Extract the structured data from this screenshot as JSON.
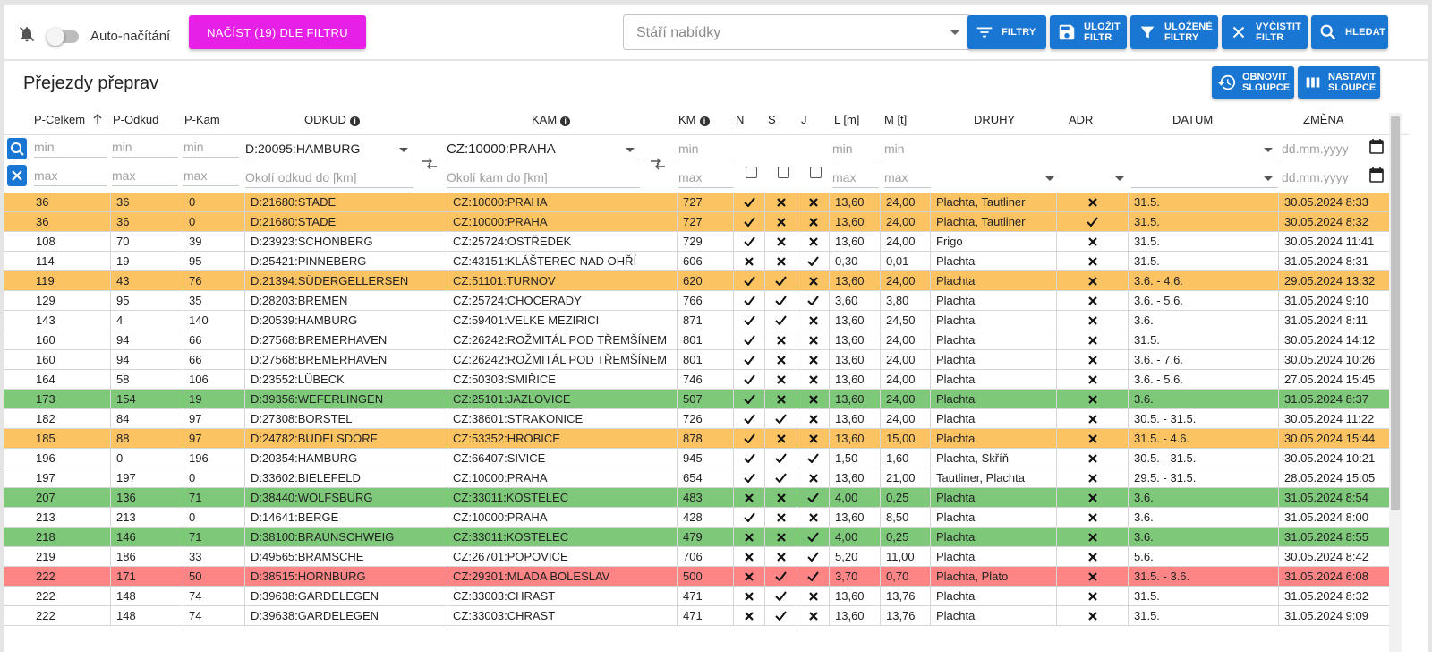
{
  "toolbar": {
    "auto_label": "Auto-načítání",
    "load_button": "NAČÍST (19) DLE FILTRU",
    "age_placeholder": "Stáří nabídky",
    "buttons": {
      "filters": "FILTRY",
      "save_filter_1": "ULOŽIT",
      "save_filter_2": "FILTR",
      "saved_filters_1": "ULOŽENÉ",
      "saved_filters_2": "FILTRY",
      "clear_filter_1": "VYČISTIT",
      "clear_filter_2": "FILTR",
      "search": "HLEDAT"
    },
    "colors": {
      "magenta": "#e620e6",
      "primary": "#1976d2",
      "indicator": "#f01e1e"
    }
  },
  "card": {
    "title": "Přejezdy přeprav",
    "refresh_1": "OBNOVIT",
    "refresh_2": "SLOUPCE",
    "setup_1": "NASTAVIT",
    "setup_2": "SLOUPCE"
  },
  "columns": {
    "p_celkem": "P-Celkem",
    "p_odkud": "P-Odkud",
    "p_kam": "P-Kam",
    "odkud": "ODKUD",
    "kam": "KAM",
    "km": "KM",
    "n": "N",
    "s": "S",
    "j": "J",
    "l": "L [m]",
    "m": "M [t]",
    "druhy": "DRUHY",
    "adr": "ADR",
    "datum": "DATUM",
    "zmena": "ZMĚNA"
  },
  "filters": {
    "min": "min",
    "max": "max",
    "odkud_value": "D:20095:HAMBURG",
    "kam_value": "CZ:10000:PRAHA",
    "odkud_radius": "Okolí odkud do [km]",
    "kam_radius": "Okolí kam do [km]",
    "date_placeholder": "dd.mm.yyyy"
  },
  "row_colors": {
    "orange": "#fcc362",
    "green": "#7ec87a",
    "red": "#fd8585"
  },
  "rows": [
    {
      "color": "orange",
      "pc": "36",
      "po": "36",
      "pk": "0",
      "odkud": "D:21680:STADE",
      "kam": "CZ:10000:PRAHA",
      "km": "727",
      "n": "yes",
      "s": "no",
      "j": "no",
      "l": "13,60",
      "m": "24,00",
      "druhy": "Plachta, Tautliner",
      "adr": "no",
      "datum": "31.5.",
      "zmena": "30.05.2024 8:33"
    },
    {
      "color": "orange",
      "pc": "36",
      "po": "36",
      "pk": "0",
      "odkud": "D:21680:STADE",
      "kam": "CZ:10000:PRAHA",
      "km": "727",
      "n": "yes",
      "s": "no",
      "j": "no",
      "l": "13,60",
      "m": "24,00",
      "druhy": "Plachta, Tautliner",
      "adr": "yes",
      "datum": "31.5.",
      "zmena": "30.05.2024 8:32"
    },
    {
      "color": "white",
      "pc": "108",
      "po": "70",
      "pk": "39",
      "odkud": "D:23923:SCHÖNBERG",
      "kam": "CZ:25724:OSTŘEDEK",
      "km": "729",
      "n": "yes",
      "s": "no",
      "j": "no",
      "l": "13,60",
      "m": "24,00",
      "druhy": "Frigo",
      "adr": "no",
      "datum": "31.5.",
      "zmena": "30.05.2024 11:41"
    },
    {
      "color": "white",
      "pc": "114",
      "po": "19",
      "pk": "95",
      "odkud": "D:25421:PINNEBERG",
      "kam": "CZ:43151:KLÁŠTEREC NAD OHŘÍ",
      "km": "606",
      "n": "no",
      "s": "no",
      "j": "yes",
      "l": "0,30",
      "m": "0,01",
      "druhy": "Plachta",
      "adr": "no",
      "datum": "31.5.",
      "zmena": "31.05.2024 8:31"
    },
    {
      "color": "orange",
      "pc": "119",
      "po": "43",
      "pk": "76",
      "odkud": "D:21394:SÜDERGELLERSEN",
      "kam": "CZ:51101:TURNOV",
      "km": "620",
      "n": "yes",
      "s": "yes",
      "j": "no",
      "l": "13,60",
      "m": "24,00",
      "druhy": "Plachta",
      "adr": "no",
      "datum": "3.6. - 4.6.",
      "zmena": "29.05.2024 13:32"
    },
    {
      "color": "white",
      "pc": "129",
      "po": "95",
      "pk": "35",
      "odkud": "D:28203:BREMEN",
      "kam": "CZ:25724:CHOCERADY",
      "km": "766",
      "n": "yes",
      "s": "yes",
      "j": "yes",
      "l": "3,60",
      "m": "3,80",
      "druhy": "Plachta",
      "adr": "no",
      "datum": "3.6. - 5.6.",
      "zmena": "31.05.2024 9:10"
    },
    {
      "color": "white",
      "pc": "143",
      "po": "4",
      "pk": "140",
      "odkud": "D:20539:HAMBURG",
      "kam": "CZ:59401:VELKE MEZIRICI",
      "km": "871",
      "n": "yes",
      "s": "yes",
      "j": "no",
      "l": "13,60",
      "m": "24,50",
      "druhy": "Plachta",
      "adr": "no",
      "datum": "3.6.",
      "zmena": "31.05.2024 8:11"
    },
    {
      "color": "white",
      "pc": "160",
      "po": "94",
      "pk": "66",
      "odkud": "D:27568:BREMERHAVEN",
      "kam": "CZ:26242:ROŽMITÁL POD TŘEMŠÍNEM",
      "km": "801",
      "n": "yes",
      "s": "no",
      "j": "no",
      "l": "13,60",
      "m": "24,00",
      "druhy": "Plachta",
      "adr": "no",
      "datum": "31.5.",
      "zmena": "30.05.2024 14:12"
    },
    {
      "color": "white",
      "pc": "160",
      "po": "94",
      "pk": "66",
      "odkud": "D:27568:BREMERHAVEN",
      "kam": "CZ:26242:ROŽMITÁL POD TŘEMŠÍNEM",
      "km": "801",
      "n": "yes",
      "s": "no",
      "j": "no",
      "l": "13,60",
      "m": "24,00",
      "druhy": "Plachta",
      "adr": "no",
      "datum": "3.6. - 7.6.",
      "zmena": "30.05.2024 10:26"
    },
    {
      "color": "white",
      "pc": "164",
      "po": "58",
      "pk": "106",
      "odkud": "D:23552:LÜBECK",
      "kam": "CZ:50303:SMIŘICE",
      "km": "746",
      "n": "yes",
      "s": "no",
      "j": "no",
      "l": "13,60",
      "m": "24,00",
      "druhy": "Plachta",
      "adr": "no",
      "datum": "3.6. - 5.6.",
      "zmena": "27.05.2024 15:45"
    },
    {
      "color": "green",
      "pc": "173",
      "po": "154",
      "pk": "19",
      "odkud": "D:39356:WEFERLINGEN",
      "kam": "CZ:25101:JAZLOVICE",
      "km": "507",
      "n": "yes",
      "s": "no",
      "j": "no",
      "l": "13,60",
      "m": "24,00",
      "druhy": "Plachta",
      "adr": "no",
      "datum": "3.6.",
      "zmena": "31.05.2024 8:37"
    },
    {
      "color": "white",
      "pc": "182",
      "po": "84",
      "pk": "97",
      "odkud": "D:27308:BORSTEL",
      "kam": "CZ:38601:STRAKONICE",
      "km": "726",
      "n": "yes",
      "s": "yes",
      "j": "no",
      "l": "13,60",
      "m": "24,00",
      "druhy": "Plachta",
      "adr": "no",
      "datum": "30.5. - 31.5.",
      "zmena": "30.05.2024 11:22"
    },
    {
      "color": "orange",
      "pc": "185",
      "po": "88",
      "pk": "97",
      "odkud": "D:24782:BÜDELSDORF",
      "kam": "CZ:53352:HROBICE",
      "km": "878",
      "n": "yes",
      "s": "no",
      "j": "no",
      "l": "13,60",
      "m": "15,00",
      "druhy": "Plachta",
      "adr": "no",
      "datum": "31.5. - 4.6.",
      "zmena": "30.05.2024 15:44"
    },
    {
      "color": "white",
      "pc": "196",
      "po": "0",
      "pk": "196",
      "odkud": "D:20354:HAMBURG",
      "kam": "CZ:66407:SIVICE",
      "km": "945",
      "n": "yes",
      "s": "yes",
      "j": "yes",
      "l": "1,50",
      "m": "1,60",
      "druhy": "Plachta, Skříň",
      "adr": "no",
      "datum": "30.5. - 31.5.",
      "zmena": "30.05.2024 10:21"
    },
    {
      "color": "white",
      "pc": "197",
      "po": "197",
      "pk": "0",
      "odkud": "D:33602:BIELEFELD",
      "kam": "CZ:10000:PRAHA",
      "km": "654",
      "n": "yes",
      "s": "yes",
      "j": "no",
      "l": "13,60",
      "m": "21,00",
      "druhy": "Tautliner, Plachta",
      "adr": "no",
      "datum": "29.5. - 31.5.",
      "zmena": "28.05.2024 15:05"
    },
    {
      "color": "green",
      "pc": "207",
      "po": "136",
      "pk": "71",
      "odkud": "D:38440:WOLFSBURG",
      "kam": "CZ:33011:KOSTELEC",
      "km": "483",
      "n": "no",
      "s": "no",
      "j": "yes",
      "l": "4,00",
      "m": "0,25",
      "druhy": "Plachta",
      "adr": "no",
      "datum": "3.6.",
      "zmena": "31.05.2024 8:54"
    },
    {
      "color": "white",
      "pc": "213",
      "po": "213",
      "pk": "0",
      "odkud": "D:14641:BERGE",
      "kam": "CZ:10000:PRAHA",
      "km": "428",
      "n": "yes",
      "s": "no",
      "j": "no",
      "l": "13,60",
      "m": "8,50",
      "druhy": "Plachta",
      "adr": "no",
      "datum": "3.6.",
      "zmena": "31.05.2024 8:00"
    },
    {
      "color": "green",
      "pc": "218",
      "po": "146",
      "pk": "71",
      "odkud": "D:38100:BRAUNSCHWEIG",
      "kam": "CZ:33011:KOSTELEC",
      "km": "479",
      "n": "no",
      "s": "no",
      "j": "yes",
      "l": "4,00",
      "m": "0,25",
      "druhy": "Plachta",
      "adr": "no",
      "datum": "3.6.",
      "zmena": "31.05.2024 8:55"
    },
    {
      "color": "white",
      "pc": "219",
      "po": "186",
      "pk": "33",
      "odkud": "D:49565:BRAMSCHE",
      "kam": "CZ:26701:POPOVICE",
      "km": "706",
      "n": "no",
      "s": "no",
      "j": "yes",
      "l": "5,20",
      "m": "11,00",
      "druhy": "Plachta",
      "adr": "no",
      "datum": "5.6.",
      "zmena": "30.05.2024 8:42"
    },
    {
      "color": "red",
      "pc": "222",
      "po": "171",
      "pk": "50",
      "odkud": "D:38515:HORNBURG",
      "kam": "CZ:29301:MLADA BOLESLAV",
      "km": "500",
      "n": "no",
      "s": "yes",
      "j": "yes",
      "l": "3,70",
      "m": "0,70",
      "druhy": "Plachta, Plato",
      "adr": "no",
      "datum": "31.5. - 3.6.",
      "zmena": "31.05.2024 6:08"
    },
    {
      "color": "white",
      "pc": "222",
      "po": "148",
      "pk": "74",
      "odkud": "D:39638:GARDELEGEN",
      "kam": "CZ:33003:CHRAST",
      "km": "471",
      "n": "no",
      "s": "yes",
      "j": "no",
      "l": "13,60",
      "m": "13,76",
      "druhy": "Plachta",
      "adr": "no",
      "datum": "31.5.",
      "zmena": "31.05.2024 8:32"
    },
    {
      "color": "white",
      "pc": "222",
      "po": "148",
      "pk": "74",
      "odkud": "D:39638:GARDELEGEN",
      "kam": "CZ:33003:CHRAST",
      "km": "471",
      "n": "no",
      "s": "yes",
      "j": "no",
      "l": "13,60",
      "m": "13,76",
      "druhy": "Plachta",
      "adr": "no",
      "datum": "31.5.",
      "zmena": "31.05.2024 9:09"
    }
  ]
}
